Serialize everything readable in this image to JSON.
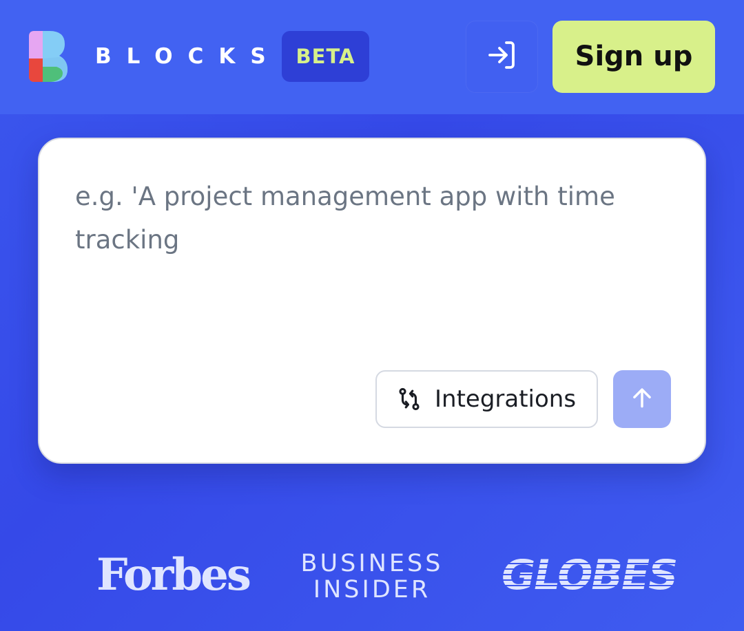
{
  "header": {
    "brand": "BLOCKS",
    "badge": "BETA",
    "login_icon": "login-arrow-icon",
    "signup_label": "Sign up"
  },
  "prompt": {
    "placeholder": "e.g. 'A project management app with time tracking",
    "value": ""
  },
  "actions": {
    "integrations_label": "Integrations",
    "integrations_icon": "git-compare-icon",
    "send_icon": "arrow-up-icon"
  },
  "press": {
    "forbes": "Forbes",
    "business_insider_line1": "BUSINESS",
    "business_insider_line2": "INSIDER",
    "globes": "GLOBES"
  },
  "colors": {
    "background": "#3b57ee",
    "header": "#4262f2",
    "accent_lime": "#d8f08a",
    "beta_badge": "#2e3fd6",
    "send_button": "#9cacf6",
    "placeholder_text": "#6b7583"
  }
}
